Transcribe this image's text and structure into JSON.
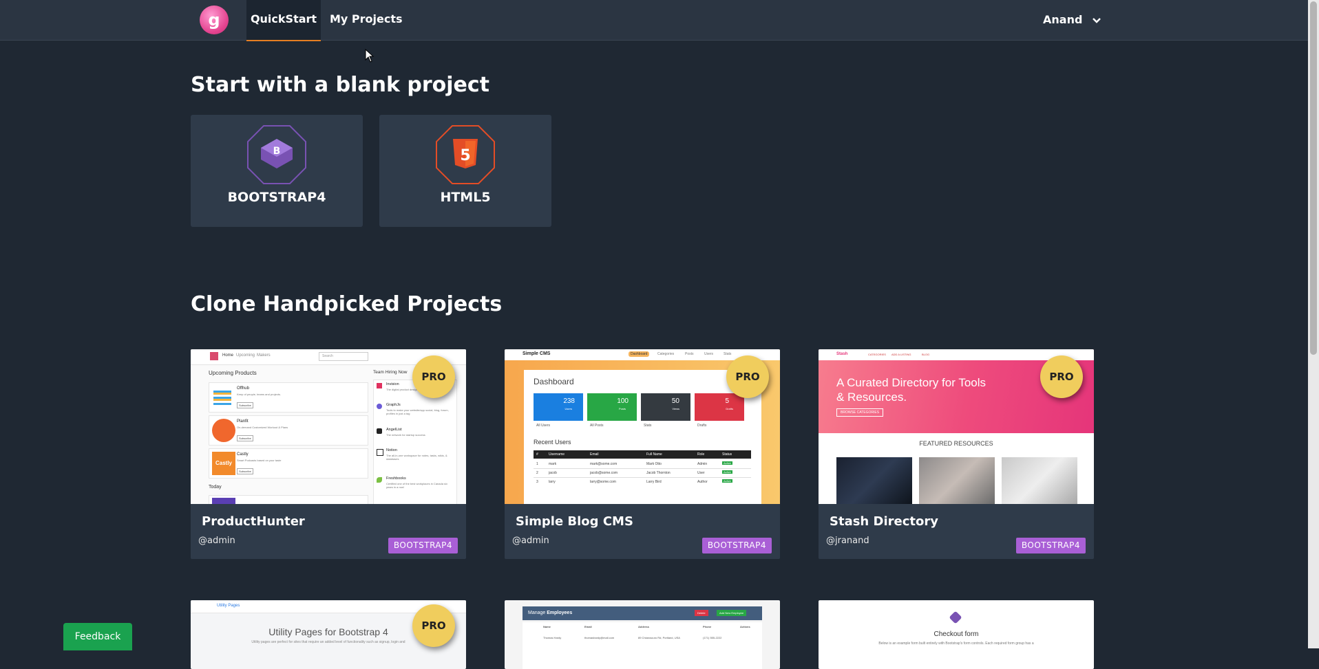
{
  "nav": {
    "logo_letter": "g",
    "quickstart": "QuickStart",
    "my_projects": "My Projects",
    "user": "Anand"
  },
  "blank": {
    "heading": "Start with a blank project",
    "starters": [
      {
        "label": "BOOTSTRAP4",
        "icon": "bootstrap-icon",
        "color": "#7952b3"
      },
      {
        "label": "HTML5",
        "icon": "html5-icon",
        "color": "#e44d26"
      }
    ]
  },
  "clone": {
    "heading": "Clone Handpicked Projects",
    "projects": [
      {
        "title": "ProductHunter",
        "author": "@admin",
        "tag": "BOOTSTRAP4",
        "badge": "PRO"
      },
      {
        "title": "Simple Blog CMS",
        "author": "@admin",
        "tag": "BOOTSTRAP4",
        "badge": "PRO"
      },
      {
        "title": "Stash Directory",
        "author": "@jranand",
        "tag": "BOOTSTRAP4",
        "badge": "PRO"
      }
    ],
    "row2_badge": "PRO"
  },
  "thumbs": {
    "ph": {
      "nav": [
        "Home",
        "Upcoming",
        "Makers"
      ],
      "search": "Search",
      "heading": "Upcoming Products",
      "side_heading": "Team Hiring Now",
      "items": [
        {
          "name": "Offhub",
          "desc": "Keep of people, teams and projects."
        },
        {
          "name": "Planfit",
          "desc": "On-demand Customized Workout & Plans"
        },
        {
          "name": "Castly",
          "desc": "Smart Podcasts based on your taste"
        }
      ],
      "subscribe": "Subscribe",
      "today": "Today",
      "hiring": [
        {
          "name": "Invision",
          "desc": "The digital product design platform"
        },
        {
          "name": "GraphJs",
          "desc": "Tools to make your website/app social, blog, forum, profiles in just a tag"
        },
        {
          "name": "AngelList",
          "desc": "The network for startup success"
        },
        {
          "name": "Notion",
          "desc": "The all-in-one workspace for notes, tasks, wikis, & databases"
        },
        {
          "name": "Freshbooks",
          "desc": "Certified one of the best workplaces in Canada six years in a row!"
        }
      ]
    },
    "cms": {
      "brand": "Simple CMS",
      "nav": [
        "Dashboard",
        "Categories",
        "Posts",
        "Users",
        "Stats"
      ],
      "heading": "Dashboard",
      "stats": [
        {
          "value": "238",
          "label": "Users",
          "link": "All Users",
          "color": "#1a7fe0"
        },
        {
          "value": "100",
          "label": "Posts",
          "link": "All Posts",
          "color": "#28a745"
        },
        {
          "value": "50",
          "label": "Views",
          "link": "Stats",
          "color": "#343a40"
        },
        {
          "value": "5",
          "label": "Drafts",
          "link": "Drafts",
          "color": "#dc3545"
        }
      ],
      "recent": "Recent Users",
      "columns": [
        "#",
        "Username",
        "Email",
        "Full Name",
        "Role",
        "Status"
      ],
      "rows": [
        [
          "1",
          "mark",
          "mark@some.com",
          "Mark Otto",
          "Admin",
          "Active"
        ],
        [
          "2",
          "jacob",
          "jacob@some.com",
          "Jacob Thornton",
          "User",
          "Active"
        ],
        [
          "3",
          "larry",
          "larry@some.com",
          "Larry Bird",
          "Author",
          "Active"
        ]
      ]
    },
    "stash": {
      "brand": "Stash",
      "nav": [
        "CATEGORIES",
        "ADD A LISTING",
        "BLOG"
      ],
      "hero": "A Curated Directory for Tools & Resources.",
      "button": "BROWSE CATEGORIES",
      "featured": "FEATURED RESOURCES"
    },
    "utility": {
      "brand": "Utility Pages",
      "title": "Utility Pages for Bootstrap 4",
      "desc": "Utility pages are perfect for sites that require an added level of functionality such as signup, login and"
    },
    "employees": {
      "manage": "Manage",
      "title": "Employees",
      "delete": "Delete",
      "add": "Add New Employee",
      "columns": [
        "Name",
        "Email",
        "Address",
        "Phone",
        "Actions"
      ],
      "row": [
        "Thomas Hardy",
        "thomashardy@mail.com",
        "89 Chiaroscuro Rd, Portland, USA",
        "(171) 555-2222"
      ]
    },
    "checkout": {
      "title": "Checkout form",
      "desc": "Below is an example form built entirely with Bootstrap's form controls. Each required form group has a"
    }
  },
  "feedback": "Feedback"
}
